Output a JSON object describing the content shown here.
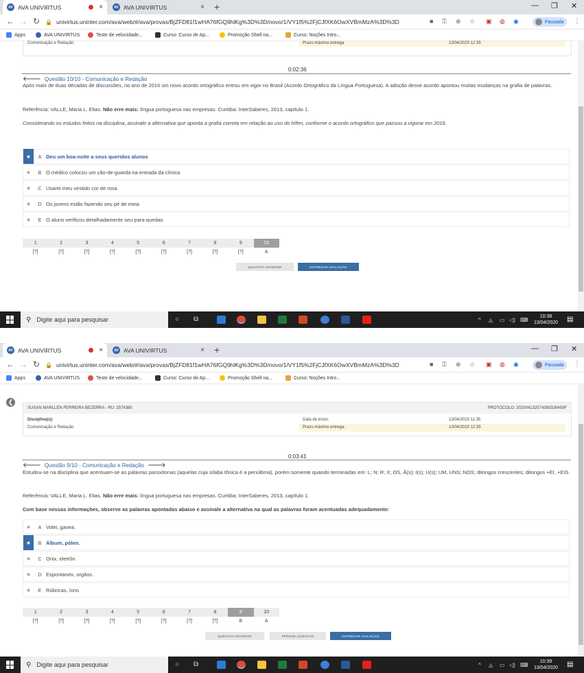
{
  "browser": {
    "tabs": [
      {
        "label": "AVA UNIVIRTUS",
        "close": "×"
      },
      {
        "label": "AVA UNIVIRTUS",
        "close": "×"
      }
    ],
    "new_tab": "+",
    "url": "univirtus.uninter.com/ava/web/#/ava/provas/BjZFD81f1wHA76fGQ9hlKg%3D%3D/novo/1/VY1f5%2FjCJfXK6OwXVBmMzA%3D%3D",
    "profile_status": "Pausada",
    "bookmarks": [
      "Apps",
      "AVA UNIVIRTUS",
      "Teste de velocidade...",
      "Curso: Curso de Ap...",
      "Promoção Shell na...",
      "Curso: Noções Intro..."
    ]
  },
  "screen1": {
    "timer": "0:02:36",
    "question_title": "Questão 10/10 - Comunicação e Redação",
    "intro": "Após mais de duas décadas de discussões, no ano de 2016 um novo acordo ortográfico entrou em vigor no Brasil (Acordo Ortográfico da Língua Portuguesa). A adoção desse acordo apontou muitas mudanças na grafia de palavras.",
    "reference_prefix": "Referência: VALLE, Maria L. Elias.",
    "reference_bold": "Não erre mais:",
    "reference_suffix": "língua portuguesa nas empresas. Curitiba: InterSaberes, 2013, capítulo 1.",
    "prompt": "Considerando os estudos feitos na disciplina, assinale a alternativa que aponta a grafia correta em relação ao uso do hífen, conforme o acordo ortográfico que passou a vigorar em 2016.",
    "options": [
      {
        "letter": "A",
        "text": "Deu um boa-noite a seus queridos alunos"
      },
      {
        "letter": "B",
        "text": "O médico colocou um cão-de-guarda na entrada da clínica"
      },
      {
        "letter": "C",
        "text": "Usarei meu vestido cor de rosa"
      },
      {
        "letter": "D",
        "text": "Os jovens estão fazendo seu pé de meia"
      },
      {
        "letter": "E",
        "text": "O aluno verificou detalhadamente seu para-quedas"
      }
    ],
    "selected_index": 0,
    "nav": [
      {
        "n": "1",
        "a": "[?]"
      },
      {
        "n": "2",
        "a": "[?]"
      },
      {
        "n": "3",
        "a": "[?]"
      },
      {
        "n": "4",
        "a": "[?]"
      },
      {
        "n": "5",
        "a": "[?]"
      },
      {
        "n": "6",
        "a": "[?]"
      },
      {
        "n": "7",
        "a": "[?]"
      },
      {
        "n": "8",
        "a": "[?]"
      },
      {
        "n": "9",
        "a": "[?]"
      },
      {
        "n": "10",
        "a": "A"
      }
    ],
    "current_index": 9,
    "buttons": {
      "prev": "QUESTÃO ANTERIOR",
      "submit": "ENTREGAR AVALIAÇÃO"
    },
    "top_fragment_left": "Comunicação e Redação",
    "top_fragment_mid": "Prazo máximo entrega",
    "top_fragment_right": "13/04/2020 12:35",
    "clock_time": "10:38",
    "clock_date": "13/04/2020"
  },
  "screen2": {
    "student": "SUSAN MARLLEN FERREIRA BEZERRA - RU: 2574380",
    "protocol": "PROTOCOLO: 20200413257438032645​9F",
    "discipline_label": "Disciplina(s):",
    "discipline_value": "Comunicação e Redação",
    "start_label": "Data de início:",
    "start_value": "13/04/2020 11:35",
    "deadline_label": "Prazo máximo entrega:",
    "deadline_value": "13/04/2020 12:35",
    "timer": "0:03:41",
    "question_title": "Questão 9/10 - Comunicação e Redação",
    "intro": "Estudou-se na disciplina que acentuam-se as palavras paroxítonas (aquelas cuja sílaba tônica é a penúltima), porém somente quando terminadas em: L; N; R; X; OS, Ã(s); I(s); U(s); UM, UNS; NOS; ditongos crescentes; ditongos +EI, +EIS.",
    "reference_prefix": "Referência: VALLE, Maria L. Elias.",
    "reference_bold": "Não erre mais:",
    "reference_suffix": "língua portuguesa nas empresas. Curitiba: InterSaberes, 2013, capítulo 1.",
    "prompt": "Com base nessas informações, observe as palavras apontadas abaixo e assinale a alternativa na qual as palavras foram acentuadas adequadamente:",
    "options": [
      {
        "letter": "A",
        "text": "Volei, gavea."
      },
      {
        "letter": "B",
        "text": "Álbum, pólen."
      },
      {
        "letter": "C",
        "text": "Onix, eletrôn."
      },
      {
        "letter": "D",
        "text": "Espontaneo, orgãos."
      },
      {
        "letter": "E",
        "text": "Rúbricas, íons"
      }
    ],
    "selected_index": 1,
    "nav": [
      {
        "n": "1",
        "a": "[?]"
      },
      {
        "n": "2",
        "a": "[?]"
      },
      {
        "n": "3",
        "a": "[?]"
      },
      {
        "n": "4",
        "a": "[?]"
      },
      {
        "n": "5",
        "a": "[?]"
      },
      {
        "n": "6",
        "a": "[?]"
      },
      {
        "n": "7",
        "a": "[?]"
      },
      {
        "n": "8",
        "a": "[?]"
      },
      {
        "n": "9",
        "a": "B"
      },
      {
        "n": "10",
        "a": "A"
      }
    ],
    "current_index": 8,
    "buttons": {
      "prev": "QUESTÃO ANTERIOR",
      "next": "PRÓXIMA QUESTÃO",
      "submit": "ENTREGAR AVALIAÇÃO"
    },
    "clock_time": "10:39",
    "clock_date": "13/04/2020"
  },
  "taskbar": {
    "search_placeholder": "Digite aqui para pesquisar"
  },
  "colors": {
    "accent": "#3a6ea5",
    "title_blue": "#3366a8",
    "highlight": "#fbf5dc",
    "taskbar": "#1f1f1f"
  }
}
